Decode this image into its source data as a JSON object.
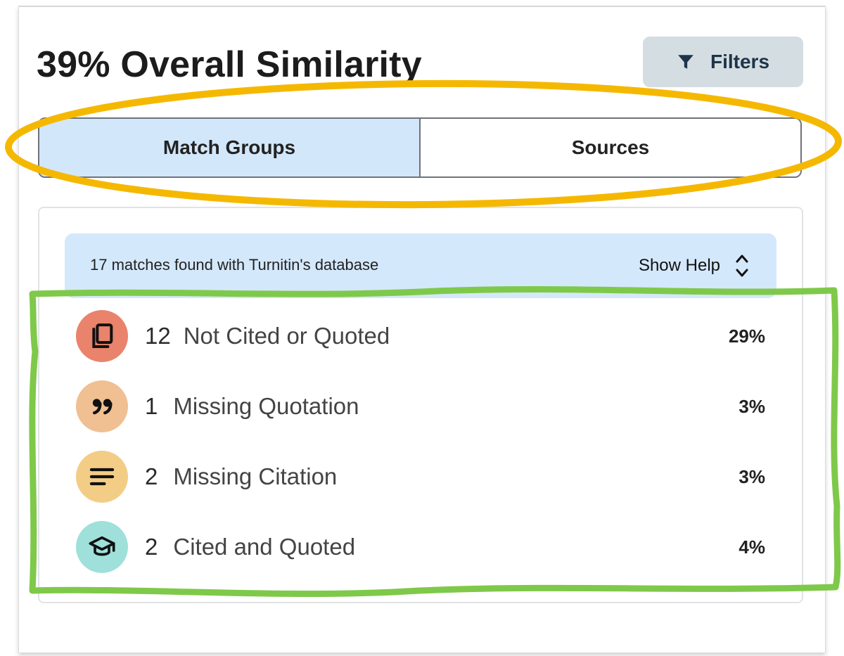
{
  "header": {
    "title": "39% Overall Similarity",
    "filters_label": "Filters"
  },
  "tabs": [
    {
      "label": "Match Groups",
      "active": true
    },
    {
      "label": "Sources",
      "active": false
    }
  ],
  "banner": {
    "text": "17 matches found with Turnitin's database",
    "help_label": "Show Help"
  },
  "match_groups": [
    {
      "count": "12",
      "label": "Not Cited or Quoted",
      "percent": "29%",
      "icon": "copy-icon",
      "color": "#e9836c"
    },
    {
      "count": "1",
      "label": "Missing Quotation",
      "percent": "3%",
      "icon": "quote-icon",
      "color": "#f0c092"
    },
    {
      "count": "2",
      "label": "Missing Citation",
      "percent": "3%",
      "icon": "text-lines-icon",
      "color": "#f3cd86"
    },
    {
      "count": "2",
      "label": "Cited and Quoted",
      "percent": "4%",
      "icon": "graduation-cap-icon",
      "color": "#9fe0da"
    }
  ],
  "annotation_colors": {
    "tabs_highlight": "#f5b800",
    "list_highlight": "#7fc94a"
  }
}
